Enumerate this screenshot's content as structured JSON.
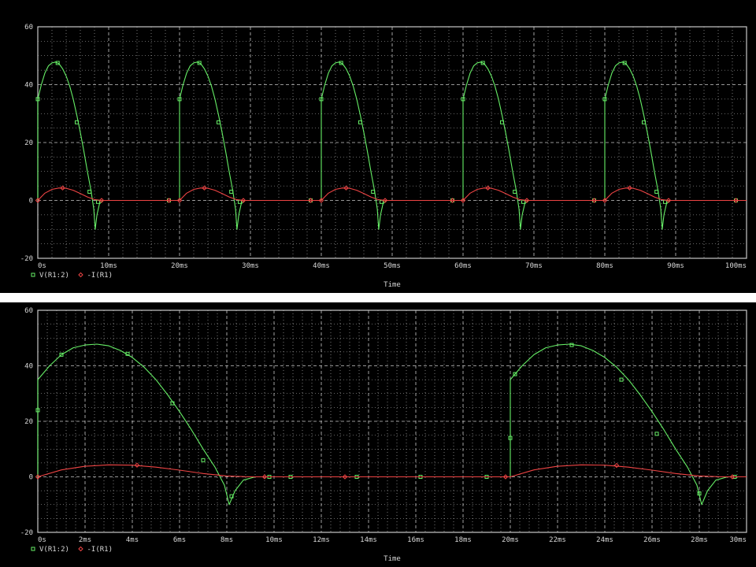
{
  "colors": {
    "background": "#000000",
    "frame": "#c8c8c8",
    "grid": "#c8c8c8",
    "green_series": "#66ee66",
    "red_series": "#ee4444",
    "text": "#d8d8d8"
  },
  "chart_data": [
    {
      "type": "line",
      "title": "",
      "xlabel": "Time",
      "ylabel": "",
      "xlim": [
        0,
        100
      ],
      "ylim": [
        -20,
        60
      ],
      "x_unit": "ms",
      "grid": true,
      "legend_position": "bottom-left",
      "x_ticks": [
        0,
        10,
        20,
        30,
        40,
        50,
        60,
        70,
        80,
        90,
        100
      ],
      "x_tick_labels": [
        "0s",
        "10ms",
        "20ms",
        "30ms",
        "40ms",
        "50ms",
        "60ms",
        "70ms",
        "80ms",
        "90ms",
        "100ms"
      ],
      "y_ticks": [
        -20,
        0,
        20,
        40,
        60
      ],
      "y_tick_labels": [
        "-20",
        "0",
        "20",
        "40",
        "60"
      ],
      "series": [
        {
          "name": "V(R1:2)",
          "marker": "square",
          "color": "#66ee66",
          "period_ms": 20,
          "cycles": 5,
          "points_per_cycle": [
            [
              0,
              0
            ],
            [
              0,
              35
            ],
            [
              0.5,
              40
            ],
            [
              1,
              44
            ],
            [
              1.5,
              46.5
            ],
            [
              2,
              47.5
            ],
            [
              2.5,
              47.8
            ],
            [
              3,
              47.2
            ],
            [
              3.5,
              45.5
            ],
            [
              4,
              43
            ],
            [
              4.5,
              39.5
            ],
            [
              5,
              35
            ],
            [
              5.5,
              29.5
            ],
            [
              6,
              23.5
            ],
            [
              6.5,
              17
            ],
            [
              7,
              10
            ],
            [
              7.5,
              3.5
            ],
            [
              7.9,
              -3
            ],
            [
              8.1,
              -10
            ],
            [
              8.35,
              -5
            ],
            [
              8.7,
              -1.2
            ],
            [
              9.2,
              0
            ],
            [
              20,
              0
            ]
          ],
          "markers_per_cycle": [
            [
              0,
              35
            ],
            [
              2.8,
              47.5
            ],
            [
              5.5,
              27
            ],
            [
              7.3,
              3
            ],
            [
              8.5,
              -0.5
            ],
            [
              18.5,
              0
            ]
          ]
        },
        {
          "name": "-I(R1)",
          "marker": "diamond",
          "color": "#ee4444",
          "period_ms": 20,
          "cycles": 5,
          "points_per_cycle": [
            [
              0,
              0
            ],
            [
              1,
              2.5
            ],
            [
              2,
              3.8
            ],
            [
              3,
              4.3
            ],
            [
              4,
              4.2
            ],
            [
              5,
              3.5
            ],
            [
              6,
              2.4
            ],
            [
              7,
              1.2
            ],
            [
              8,
              0.3
            ],
            [
              9,
              0
            ],
            [
              20,
              0
            ]
          ],
          "markers_per_cycle": [
            [
              0,
              0
            ],
            [
              3.5,
              4.3
            ],
            [
              9,
              0
            ],
            [
              18.5,
              0
            ]
          ]
        }
      ]
    },
    {
      "type": "line",
      "title": "",
      "xlabel": "Time",
      "ylabel": "",
      "xlim": [
        0,
        30
      ],
      "ylim": [
        -20,
        60
      ],
      "x_unit": "ms",
      "grid": true,
      "legend_position": "bottom-left",
      "x_ticks": [
        0,
        2,
        4,
        6,
        8,
        10,
        12,
        14,
        16,
        18,
        20,
        22,
        24,
        26,
        28,
        30
      ],
      "x_tick_labels": [
        "0s",
        "2ms",
        "4ms",
        "6ms",
        "8ms",
        "10ms",
        "12ms",
        "14ms",
        "16ms",
        "18ms",
        "20ms",
        "22ms",
        "24ms",
        "26ms",
        "28ms",
        "30ms"
      ],
      "y_ticks": [
        -20,
        0,
        20,
        40,
        60
      ],
      "y_tick_labels": [
        "-20",
        "0",
        "20",
        "40",
        "60"
      ],
      "series": [
        {
          "name": "V(R1:2)",
          "marker": "square",
          "color": "#66ee66",
          "points": [
            [
              0,
              0
            ],
            [
              0,
              35
            ],
            [
              0.5,
              40
            ],
            [
              1,
              44
            ],
            [
              1.5,
              46.5
            ],
            [
              2,
              47.5
            ],
            [
              2.5,
              47.8
            ],
            [
              3,
              47.2
            ],
            [
              3.5,
              45.5
            ],
            [
              4,
              43
            ],
            [
              4.5,
              39.5
            ],
            [
              5,
              35
            ],
            [
              5.5,
              29.5
            ],
            [
              6,
              23.5
            ],
            [
              6.5,
              17
            ],
            [
              7,
              10
            ],
            [
              7.5,
              3.5
            ],
            [
              7.9,
              -3
            ],
            [
              8.1,
              -10
            ],
            [
              8.35,
              -5
            ],
            [
              8.7,
              -1.2
            ],
            [
              9.2,
              0
            ],
            [
              20,
              0
            ],
            [
              20,
              35
            ],
            [
              20.5,
              40
            ],
            [
              21,
              44
            ],
            [
              21.5,
              46.5
            ],
            [
              22,
              47.5
            ],
            [
              22.5,
              47.8
            ],
            [
              23,
              47.2
            ],
            [
              23.5,
              45.5
            ],
            [
              24,
              43
            ],
            [
              24.5,
              39.5
            ],
            [
              25,
              35
            ],
            [
              25.5,
              29.5
            ],
            [
              26,
              23.5
            ],
            [
              26.5,
              17
            ],
            [
              27,
              10
            ],
            [
              27.5,
              3.5
            ],
            [
              27.9,
              -3
            ],
            [
              28.1,
              -10
            ],
            [
              28.35,
              -5
            ],
            [
              28.7,
              -1.2
            ],
            [
              29.2,
              0
            ],
            [
              30,
              0
            ]
          ],
          "markers": [
            [
              0,
              24
            ],
            [
              1,
              44
            ],
            [
              3.8,
              44.3
            ],
            [
              5.7,
              26.5
            ],
            [
              7,
              6
            ],
            [
              8.2,
              -7
            ],
            [
              9.8,
              0
            ],
            [
              10.7,
              0
            ],
            [
              13.5,
              0
            ],
            [
              16.2,
              0
            ],
            [
              19,
              0
            ],
            [
              20,
              14
            ],
            [
              20.2,
              37
            ],
            [
              22.6,
              47.5
            ],
            [
              24.7,
              35
            ],
            [
              26.2,
              15.5
            ],
            [
              28,
              -6
            ],
            [
              29.5,
              0
            ]
          ]
        },
        {
          "name": "-I(R1)",
          "marker": "diamond",
          "color": "#ee4444",
          "points": [
            [
              0,
              0
            ],
            [
              1,
              2.5
            ],
            [
              2,
              3.8
            ],
            [
              3,
              4.3
            ],
            [
              4,
              4.2
            ],
            [
              5,
              3.5
            ],
            [
              6,
              2.4
            ],
            [
              7,
              1.2
            ],
            [
              8,
              0.3
            ],
            [
              9,
              0
            ],
            [
              20,
              0
            ],
            [
              21,
              2.5
            ],
            [
              22,
              3.8
            ],
            [
              23,
              4.3
            ],
            [
              24,
              4.2
            ],
            [
              25,
              3.5
            ],
            [
              26,
              2.4
            ],
            [
              27,
              1.2
            ],
            [
              28,
              0.3
            ],
            [
              29,
              0
            ],
            [
              30,
              0
            ]
          ],
          "markers": [
            [
              0,
              0
            ],
            [
              4.2,
              4.2
            ],
            [
              9.6,
              0
            ],
            [
              13,
              0
            ],
            [
              19.8,
              0
            ],
            [
              24.5,
              4.1
            ],
            [
              29.4,
              0
            ]
          ]
        }
      ]
    }
  ]
}
